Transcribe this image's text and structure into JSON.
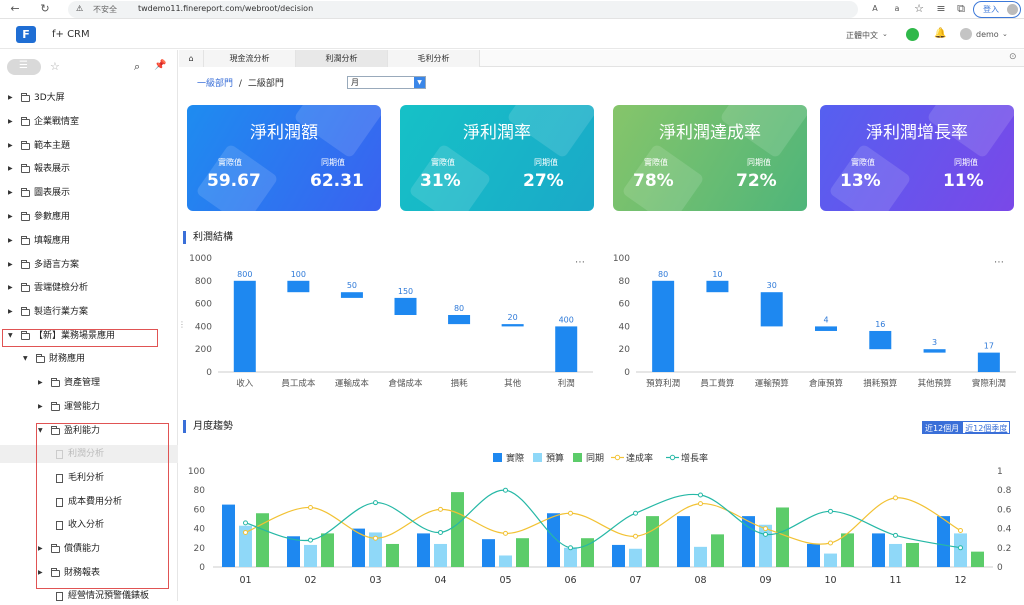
{
  "browser": {
    "insecure_label": "不安全",
    "url": "twdemo11.finereport.com/webroot/decision",
    "login_label": "登入"
  },
  "app": {
    "title": "f+ CRM",
    "language": "正體中文",
    "user": "demo"
  },
  "sidebar": {
    "items": [
      {
        "label": "3D大屏"
      },
      {
        "label": "企業戰情室"
      },
      {
        "label": "範本主題"
      },
      {
        "label": "報表展示"
      },
      {
        "label": "圖表展示"
      },
      {
        "label": "參數應用"
      },
      {
        "label": "填報應用"
      },
      {
        "label": "多語言方案"
      },
      {
        "label": "雲端健檢分析"
      },
      {
        "label": "製造行業方案"
      },
      {
        "label": "【新】業務場景應用"
      },
      {
        "label": "財務應用"
      },
      {
        "label": "資產管理"
      },
      {
        "label": "運營能力"
      },
      {
        "label": "盈利能力"
      },
      {
        "label": "利潤分析"
      },
      {
        "label": "毛利分析"
      },
      {
        "label": "成本費用分析"
      },
      {
        "label": "收入分析"
      },
      {
        "label": "償債能力"
      },
      {
        "label": "財務報表"
      },
      {
        "label": "經營情況預警儀錶板"
      }
    ]
  },
  "tabs": [
    "現金流分析",
    "利潤分析",
    "毛利分析"
  ],
  "breadcrumb": {
    "level1": "一級部門",
    "sep": "/",
    "level2": "二級部門"
  },
  "month_select": {
    "value": "月"
  },
  "kpis": [
    {
      "title": "淨利潤額",
      "actual_label": "實際值",
      "actual": "59.67",
      "prior_label": "同期值",
      "prior": "62.31",
      "color1": "#1e8cf0",
      "color2": "#3a62f0"
    },
    {
      "title": "淨利潤率",
      "actual_label": "實際值",
      "actual": "31%",
      "prior_label": "同期值",
      "prior": "27%",
      "color1": "#16c1c7",
      "color2": "#1aa9c8"
    },
    {
      "title": "淨利潤達成率",
      "actual_label": "實際值",
      "actual": "78%",
      "prior_label": "同期值",
      "prior": "72%",
      "color1": "#86c56a",
      "color2": "#4fb57a"
    },
    {
      "title": "淨利潤增長率",
      "actual_label": "實際值",
      "actual": "13%",
      "prior_label": "同期值",
      "prior": "11%",
      "color1": "#5560f0",
      "color2": "#7a48e8"
    }
  ],
  "sections": {
    "structure": "利潤結構",
    "trend": "月度趨勢"
  },
  "trend_links": [
    "近12個月",
    "近12個季度"
  ],
  "chart_data": [
    {
      "type": "bar",
      "subtype": "waterfall",
      "categories": [
        "收入",
        "員工成本",
        "運輸成本",
        "倉儲成本",
        "損耗",
        "其他",
        "利潤"
      ],
      "values": [
        800,
        100,
        50,
        150,
        80,
        20,
        400
      ],
      "bases": [
        0,
        700,
        650,
        500,
        420,
        400,
        0
      ],
      "ylim": [
        0,
        1000
      ],
      "yticks": [
        0,
        200,
        400,
        600,
        800,
        1000
      ],
      "color": "#1e88f0"
    },
    {
      "type": "bar",
      "subtype": "waterfall",
      "categories": [
        "預算利潤",
        "員工費算",
        "運輸預算",
        "倉庫預算",
        "損耗預算",
        "其他預算",
        "實際利潤"
      ],
      "values": [
        80,
        10,
        30,
        4,
        16,
        3,
        17
      ],
      "bases": [
        0,
        70,
        40,
        36,
        20,
        17,
        0
      ],
      "ylim": [
        0,
        100
      ],
      "yticks": [
        0,
        20,
        40,
        60,
        80,
        100
      ],
      "color": "#1e88f0"
    },
    {
      "type": "bar",
      "subtype": "bar-line-combo",
      "categories": [
        "01",
        "02",
        "03",
        "04",
        "05",
        "06",
        "07",
        "08",
        "09",
        "10",
        "11",
        "12"
      ],
      "series": [
        {
          "name": "實際",
          "kind": "bar",
          "axis": "left",
          "color": "#1e88f0",
          "values": [
            65,
            32,
            40,
            35,
            29,
            56,
            23,
            53,
            53,
            24,
            35,
            53
          ]
        },
        {
          "name": "預算",
          "kind": "bar",
          "axis": "left",
          "color": "#8fd8f8",
          "values": [
            43,
            23,
            36,
            24,
            12,
            20,
            19,
            21,
            44,
            14,
            24,
            35
          ]
        },
        {
          "name": "同期",
          "kind": "bar",
          "axis": "left",
          "color": "#5ccc6a",
          "values": [
            56,
            35,
            24,
            78,
            30,
            30,
            53,
            34,
            62,
            35,
            25,
            16
          ]
        },
        {
          "name": "達成率",
          "kind": "line",
          "axis": "right",
          "color": "#f2c234",
          "values": [
            0.36,
            0.62,
            0.3,
            0.6,
            0.35,
            0.56,
            0.32,
            0.66,
            0.4,
            0.25,
            0.72,
            0.38
          ]
        },
        {
          "name": "增長率",
          "kind": "line",
          "axis": "right",
          "color": "#26b8a6",
          "values": [
            0.46,
            0.28,
            0.67,
            0.36,
            0.8,
            0.2,
            0.56,
            0.75,
            0.34,
            0.58,
            0.33,
            0.2
          ]
        }
      ],
      "ylim": [
        0,
        100
      ],
      "yticks": [
        0,
        20,
        40,
        60,
        80,
        100
      ],
      "y2lim": [
        0,
        1
      ],
      "y2ticks": [
        0,
        0.2,
        0.4,
        0.6,
        0.8,
        1
      ],
      "legend": "top-center"
    }
  ]
}
